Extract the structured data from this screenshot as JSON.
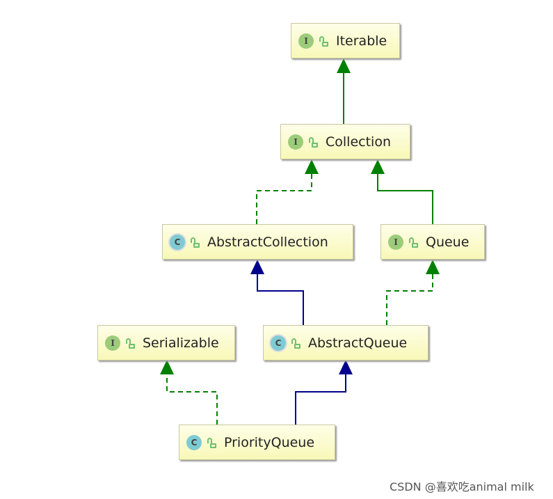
{
  "nodes": [
    {
      "id": "iterable",
      "kind": "I",
      "name": "Iterable",
      "abstract": false
    },
    {
      "id": "collection",
      "kind": "I",
      "name": "Collection",
      "abstract": false
    },
    {
      "id": "abstractcollection",
      "kind": "C",
      "name": "AbstractCollection",
      "abstract": true
    },
    {
      "id": "queue",
      "kind": "I",
      "name": "Queue",
      "abstract": false
    },
    {
      "id": "serializable",
      "kind": "I",
      "name": "Serializable",
      "abstract": false
    },
    {
      "id": "abstractqueue",
      "kind": "C",
      "name": "AbstractQueue",
      "abstract": true
    },
    {
      "id": "priorityqueue",
      "kind": "C",
      "name": "PriorityQueue",
      "abstract": false
    }
  ],
  "edges": [
    {
      "from": "collection",
      "to": "iterable",
      "type": "extends-interface",
      "style": "solid",
      "color": "#008000"
    },
    {
      "from": "abstractcollection",
      "to": "collection",
      "type": "implements",
      "style": "dashed",
      "color": "#008000"
    },
    {
      "from": "queue",
      "to": "collection",
      "type": "extends-interface",
      "style": "solid",
      "color": "#008000"
    },
    {
      "from": "abstractqueue",
      "to": "abstractcollection",
      "type": "extends",
      "style": "solid",
      "color": "#00008b"
    },
    {
      "from": "abstractqueue",
      "to": "queue",
      "type": "implements",
      "style": "dashed",
      "color": "#008000"
    },
    {
      "from": "priorityqueue",
      "to": "serializable",
      "type": "implements",
      "style": "dashed",
      "color": "#008000"
    },
    {
      "from": "priorityqueue",
      "to": "abstractqueue",
      "type": "extends",
      "style": "solid",
      "color": "#00008b"
    }
  ],
  "watermark": "CSDN @喜欢吃animal milk"
}
